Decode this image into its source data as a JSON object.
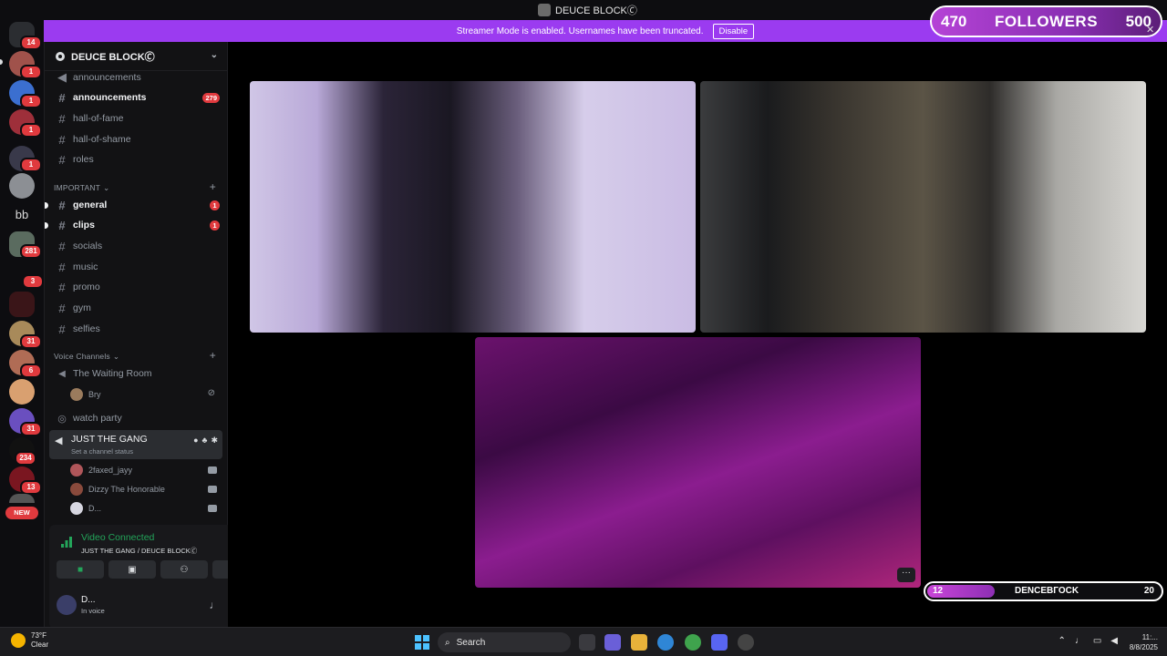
{
  "window": {
    "title": "DEUCE BLOCK🄫"
  },
  "banner": {
    "text": "Streamer Mode is enabled. Usernames have been truncated.",
    "button": "Disable"
  },
  "rail": {
    "badges": [
      "14",
      "1",
      "1",
      "1",
      "1",
      "1",
      "281",
      "3",
      "31",
      "6",
      "31",
      "234",
      "13"
    ],
    "text_server": "bb",
    "new_label": "NEW"
  },
  "sidebar": {
    "server_name": "DEUCE BLOCK🄫",
    "channels_top": [
      {
        "name": "announcements",
        "bright": false,
        "mention": ""
      },
      {
        "name": "announcements",
        "bright": true,
        "mention": "279"
      },
      {
        "name": "hall-of-fame",
        "bright": false,
        "mention": ""
      },
      {
        "name": "hall-of-shame",
        "bright": false,
        "mention": ""
      },
      {
        "name": "roles",
        "bright": false,
        "mention": ""
      }
    ],
    "category_important": "IMPORTANT",
    "channels_important": [
      {
        "name": "general",
        "bright": true,
        "mention": "1"
      },
      {
        "name": "clips",
        "bright": true,
        "mention": "1"
      },
      {
        "name": "socials",
        "bright": false,
        "mention": ""
      },
      {
        "name": "music",
        "bright": false,
        "mention": ""
      },
      {
        "name": "promo",
        "bright": false,
        "mention": ""
      },
      {
        "name": "gym",
        "bright": false,
        "mention": ""
      },
      {
        "name": "selfies",
        "bright": false,
        "mention": ""
      }
    ],
    "category_voice": "Voice Channels",
    "waiting_room": "The Waiting Room",
    "waiting_user": "Bry",
    "watch_party": "watch party",
    "active_voice": {
      "name": "JUST THE GANG",
      "status": "Set a channel status"
    },
    "voice_users": [
      "2faxed_jayy",
      "Dizzy The Honorable",
      "D..."
    ]
  },
  "voice_panel": {
    "status": "Video Connected",
    "subtitle": "JUST THE GANG / DEUCE BLOCK🄫"
  },
  "user": {
    "name": "D...",
    "status": "In voice"
  },
  "overlay": {
    "followers_current": "470",
    "followers_label": "FOLLOWERS",
    "followers_goal": "500",
    "bar_left": "12",
    "bar_name": "DENCEBГOCK",
    "bar_right": "20"
  },
  "taskbar": {
    "weather_temp": "73°F",
    "weather_desc": "Clear",
    "search_placeholder": "Search",
    "time": "11:...",
    "date": "8/8/2025"
  },
  "colors": {
    "accent": "#9b3bf0",
    "connected": "#23a55a",
    "badge": "#e03a3e"
  }
}
